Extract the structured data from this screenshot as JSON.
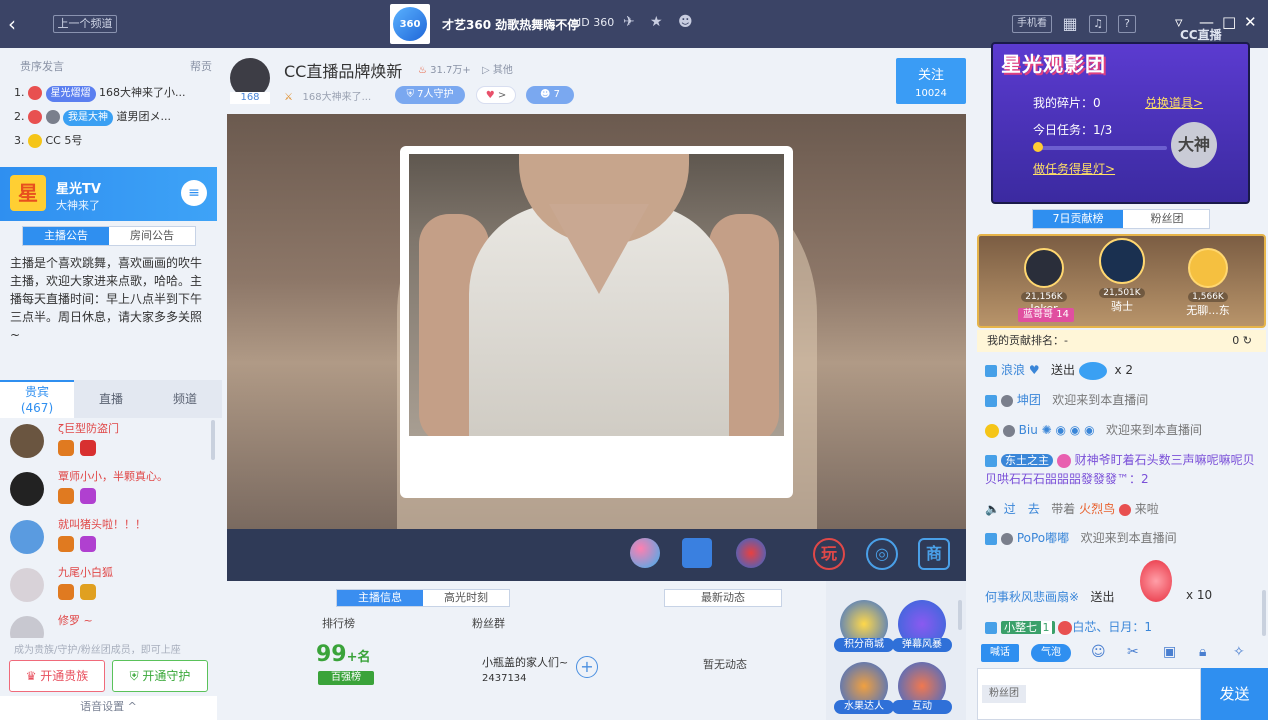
{
  "topbar": {
    "back_glyph": "‹",
    "prev_channel": "上一个频道",
    "channel_logo_text": "360",
    "channel_title": "才艺360 劲歌热舞嗨不停",
    "channel_id": "360",
    "phone_watch": "手机看",
    "icons": [
      "plane-icon",
      "star-icon",
      "users-icon",
      "grid-icon",
      "bell-icon",
      "help-icon",
      "minimize-icon",
      "maximize-icon",
      "close-icon"
    ],
    "brand": "CC直播"
  },
  "left": {
    "rank_title": "贵序发言",
    "rank_hint": "帮贡",
    "ranks": [
      {
        "no": "1.",
        "tag": "星光熠熠",
        "text": "168大神来了小..."
      },
      {
        "no": "2.",
        "tag": "我是大神",
        "text": "道男团メ..."
      },
      {
        "no": "3.",
        "tag": "",
        "text": "CC 5号"
      }
    ],
    "star_tv": {
      "logo": "星",
      "name": "星光TV",
      "sub": "大神来了"
    },
    "ann_tabs": [
      "主播公告",
      "房间公告"
    ],
    "announcement": "主播是个喜欢跳舞，喜欢画画的吹牛主播，欢迎大家进来点歌，哈哈。主播每天直播时间：早上八点半到下午三点半。周日休息，请大家多多关照~",
    "view_tabs": {
      "vip": "贵宾",
      "vip_count": "(467)",
      "live": "直播",
      "channel": "频道"
    },
    "viewers": [
      {
        "name": "ζ巨型防盗门"
      },
      {
        "name": "覃师小小，半颗真心。"
      },
      {
        "name": "就叫猪头啦！！！"
      },
      {
        "name": "九尾小白狐"
      },
      {
        "name": "修罗 ~"
      }
    ],
    "note": "成为贵族/守护/粉丝团成员，即可上座",
    "btn_noble": "开通贵族",
    "btn_guard": "开通守护",
    "voice": "语音设置 ^"
  },
  "center": {
    "host_level": "168",
    "host_name": "CC直播品牌焕新",
    "heat": "31.7万+",
    "other": "其他",
    "host_sub": "168大神来了...",
    "guard": "7人守护",
    "more": ">",
    "fans": "7",
    "follow": "关注",
    "follow_count": "10024",
    "info_tabs": [
      "主播信息",
      "高光时刻"
    ],
    "news_btn": "最新动态",
    "rank_label": "排行榜",
    "fans_label": "粉丝群",
    "rank_num": "99",
    "rank_suffix": "+名",
    "rank_badge": "百强榜",
    "fan_group": "小瓶盖的家人们~",
    "fan_group_id": "2437134",
    "no_news": "暂无动态",
    "actions": [
      "积分商城",
      "弹幕风暴",
      "水果达人",
      "互动"
    ]
  },
  "right": {
    "star_title": "星光观影团",
    "fragments": "我的碎片：0",
    "redeem": "兑换道具>",
    "task": "今日任务：1/3",
    "do_task": "做任务得星灯>",
    "god": "大神",
    "tabs": [
      "7日贡献榜",
      "粉丝团"
    ],
    "podium": [
      {
        "val": "21,156K",
        "name": "Joker"
      },
      {
        "val": "21,501K",
        "name": "骑士"
      },
      {
        "val": "1,566K",
        "name": "无聊...东"
      }
    ],
    "badge": "蓝哥哥 14",
    "my_rank_label": "我的贡献排名：",
    "my_rank_val": "-",
    "my_rank_num": "0",
    "chats": [
      {
        "user": "浪浪",
        "action": "送出",
        "extra": "x 2"
      },
      {
        "user": "坤团",
        "action": "欢迎来到本直播间",
        "extra": ""
      },
      {
        "user": "Biu",
        "action": "欢迎来到本直播间",
        "extra": ""
      },
      {
        "user": "东土之主",
        "action": "财神爷盯着石头数三声嘛呢嘛呢贝贝哄石石石㗊㗊㗊發發發™：2",
        "extra": ""
      },
      {
        "user": "过　去",
        "action": "带着",
        "extra": "火烈鸟",
        "tail": "来啦"
      },
      {
        "user": "PoPo嘟嘟",
        "action": "欢迎来到本直播间",
        "extra": ""
      },
      {
        "user": "何事秋风悲画扇※",
        "action": "送出",
        "extra": "x 10"
      },
      {
        "user": "小整七",
        "level": "1",
        "tail2": "白芯、日月：1"
      }
    ],
    "chat_tag1": "喊话",
    "chat_tag2": "气泡",
    "fan_btn": "粉丝团",
    "send": "发送"
  }
}
